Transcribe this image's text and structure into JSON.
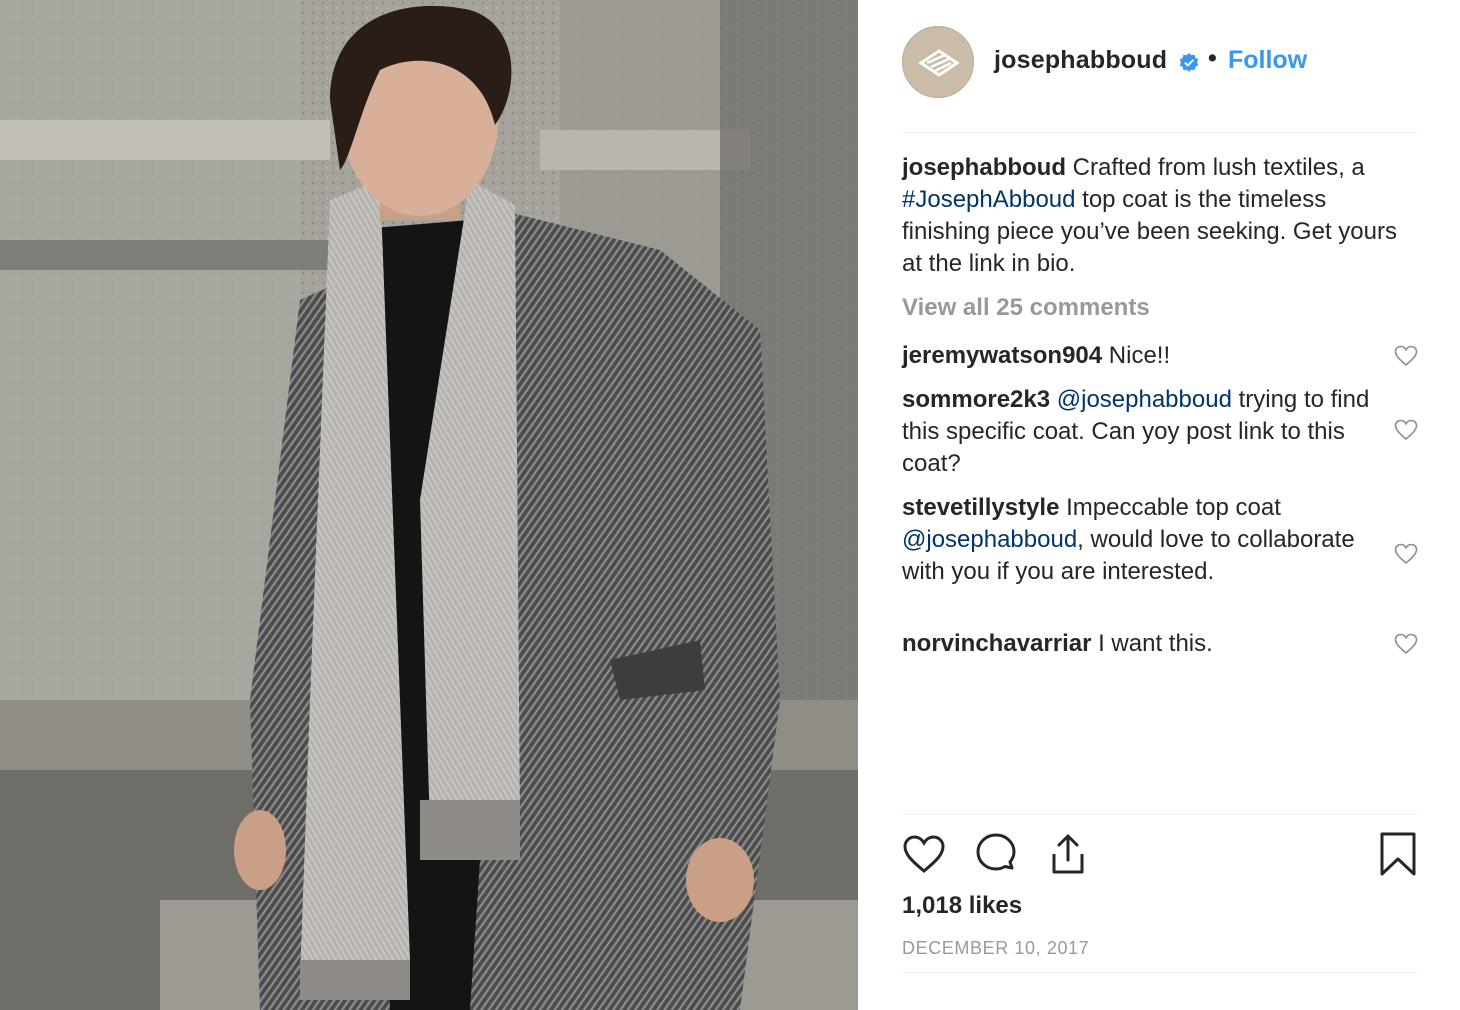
{
  "post": {
    "image_alt": "Man in grey herringbone top coat and light grey scarf standing in front of stone columns",
    "author": {
      "username": "josephabboud",
      "verified": true,
      "follow_label": "Follow",
      "separator": "•"
    },
    "caption": {
      "username": "josephabboud",
      "text_before": " Crafted from lush textiles, a ",
      "hashtag": "#JosephAbboud",
      "text_after": " top coat is the timeless finishing piece you’ve been seeking. Get yours at the link in bio."
    },
    "view_all_comments": "View all 25 comments",
    "comments": [
      {
        "username": "jeremywatson904",
        "text": " Nice!!",
        "mention": "",
        "text_after": ""
      },
      {
        "username": "sommore2k3",
        "text": " ",
        "mention": "@josephabboud",
        "text_after": " trying to find this specific coat. Can yoy post link to this coat?"
      },
      {
        "username": "stevetillystyle",
        "text": " Impeccable top coat ",
        "mention": "@josephabboud",
        "text_after": ", would love to collaborate with you if you are interested."
      },
      {
        "username": "norvinchavarriar",
        "text": " I want this.",
        "mention": "",
        "text_after": ""
      }
    ],
    "actions": {
      "like": "heart-icon",
      "comment": "comment-bubble-icon",
      "share": "share-icon",
      "save": "bookmark-icon"
    },
    "likes": "1,018 likes",
    "date": "DECEMBER 10, 2017"
  },
  "colors": {
    "link": "#3897f0",
    "hashtag": "#003569",
    "muted": "#999999",
    "avatar_bg": "#cbbca9"
  }
}
